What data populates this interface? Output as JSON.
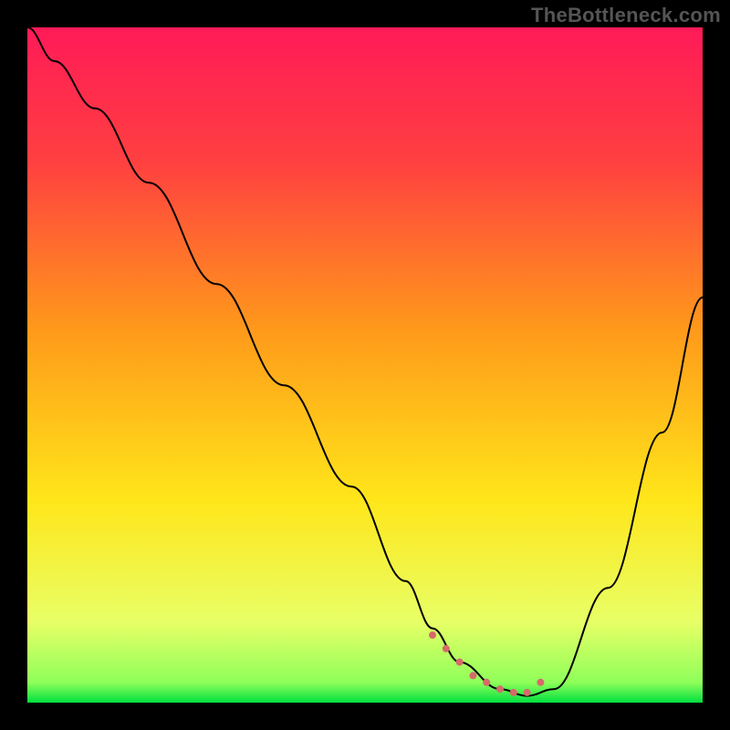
{
  "watermark": "TheBottleneck.com",
  "chart_data": {
    "type": "line",
    "title": "",
    "xlabel": "",
    "ylabel": "",
    "xlim": [
      0,
      100
    ],
    "ylim": [
      0,
      100
    ],
    "grid": false,
    "background": {
      "type": "vertical-gradient",
      "stops": [
        {
          "offset": 0.0,
          "color": "#ff1a58"
        },
        {
          "offset": 0.2,
          "color": "#ff4040"
        },
        {
          "offset": 0.45,
          "color": "#ff9a1a"
        },
        {
          "offset": 0.7,
          "color": "#ffe61a"
        },
        {
          "offset": 0.88,
          "color": "#e8ff66"
        },
        {
          "offset": 0.97,
          "color": "#8fff5a"
        },
        {
          "offset": 1.0,
          "color": "#00e040"
        }
      ]
    },
    "series": [
      {
        "name": "bottleneck-curve",
        "color": "#000000",
        "width": 2,
        "x": [
          0,
          4,
          10,
          18,
          28,
          38,
          48,
          56,
          60,
          64,
          70,
          74,
          78,
          86,
          94,
          100
        ],
        "y": [
          100,
          95,
          88,
          77,
          62,
          47,
          32,
          18,
          11,
          6,
          2,
          1,
          2,
          17,
          40,
          60
        ]
      }
    ],
    "markers": [
      {
        "name": "sweet-spot",
        "color": "#d66a6a",
        "size": 4,
        "x": [
          60,
          62,
          64,
          66,
          68,
          70,
          72,
          74,
          76
        ],
        "y": [
          10,
          8,
          6,
          4,
          3,
          2,
          1.5,
          1.5,
          3
        ]
      }
    ]
  }
}
